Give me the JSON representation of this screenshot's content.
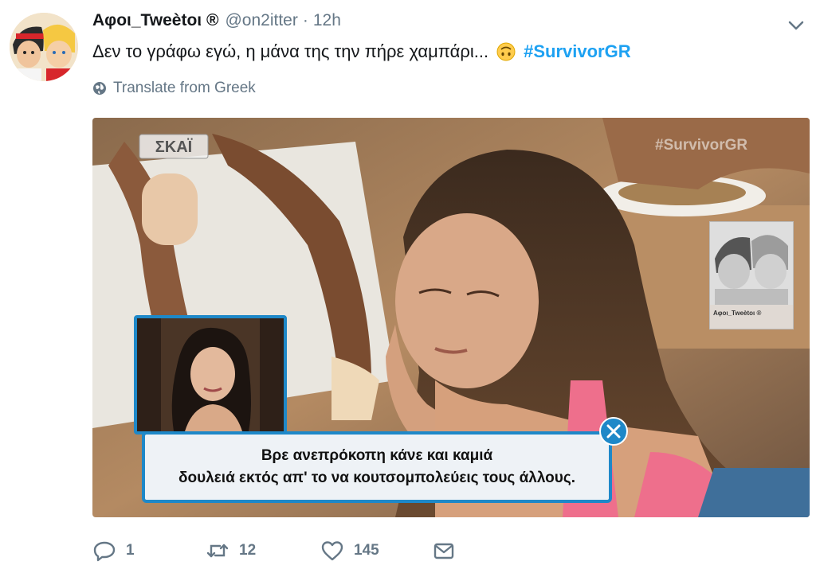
{
  "header": {
    "display_name": "Αφοι_Tweètoι ®",
    "handle": "@on2itter",
    "separator": "·",
    "time": "12h"
  },
  "tweet": {
    "text": "Δεν το γράφω εγώ, η μάνα της την πήρε χαμπάρι...",
    "hashtag": "#SurvivorGR",
    "emoji": "upside-down-face-emoji",
    "translate_label": "Translate from Greek"
  },
  "media": {
    "channel_logo": "ΣΚΑΪ",
    "watermark": "#SurvivorGR",
    "corner_card_name": "Αφοι_Tweètoι ®",
    "subtitle_line1": "Βρε ανεπρόκοπη κάνε και καμιά",
    "subtitle_line2": "δουλειά εκτός απ' το να κουτσομπολεύεις τους άλλους."
  },
  "actions": {
    "reply_count": "1",
    "retweet_count": "12",
    "like_count": "145"
  },
  "colors": {
    "accent": "#1da1f2",
    "muted": "#657786",
    "subtitle_border": "#1e88c8"
  }
}
